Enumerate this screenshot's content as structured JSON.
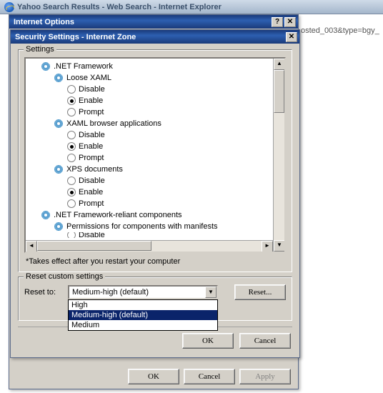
{
  "ie_title": "Yahoo Search Results - Web Search - Internet Explorer",
  "address_fragment": "osted_003&type=bgy_",
  "internet_options": {
    "title": "Internet Options",
    "ok": "OK",
    "cancel": "Cancel",
    "apply": "Apply"
  },
  "security_dialog": {
    "title": "Security Settings - Internet Zone",
    "settings_group": "Settings",
    "restart_note": "*Takes effect after you restart your computer",
    "reset_group": "Reset custom settings",
    "reset_label": "Reset to:",
    "reset_button": "Reset...",
    "ok": "OK",
    "cancel": "Cancel",
    "combo_selected": "Medium-high (default)",
    "combo_options": [
      "High",
      "Medium-high (default)",
      "Medium"
    ]
  },
  "tree": {
    "net": ".NET Framework",
    "loose": "Loose XAML",
    "xaml_apps": "XAML browser applications",
    "xps": "XPS documents",
    "reliant": ".NET Framework-reliant components",
    "permissions": "Permissions for components with manifests",
    "disable": "Disable",
    "enable": "Enable",
    "prompt": "Prompt"
  }
}
